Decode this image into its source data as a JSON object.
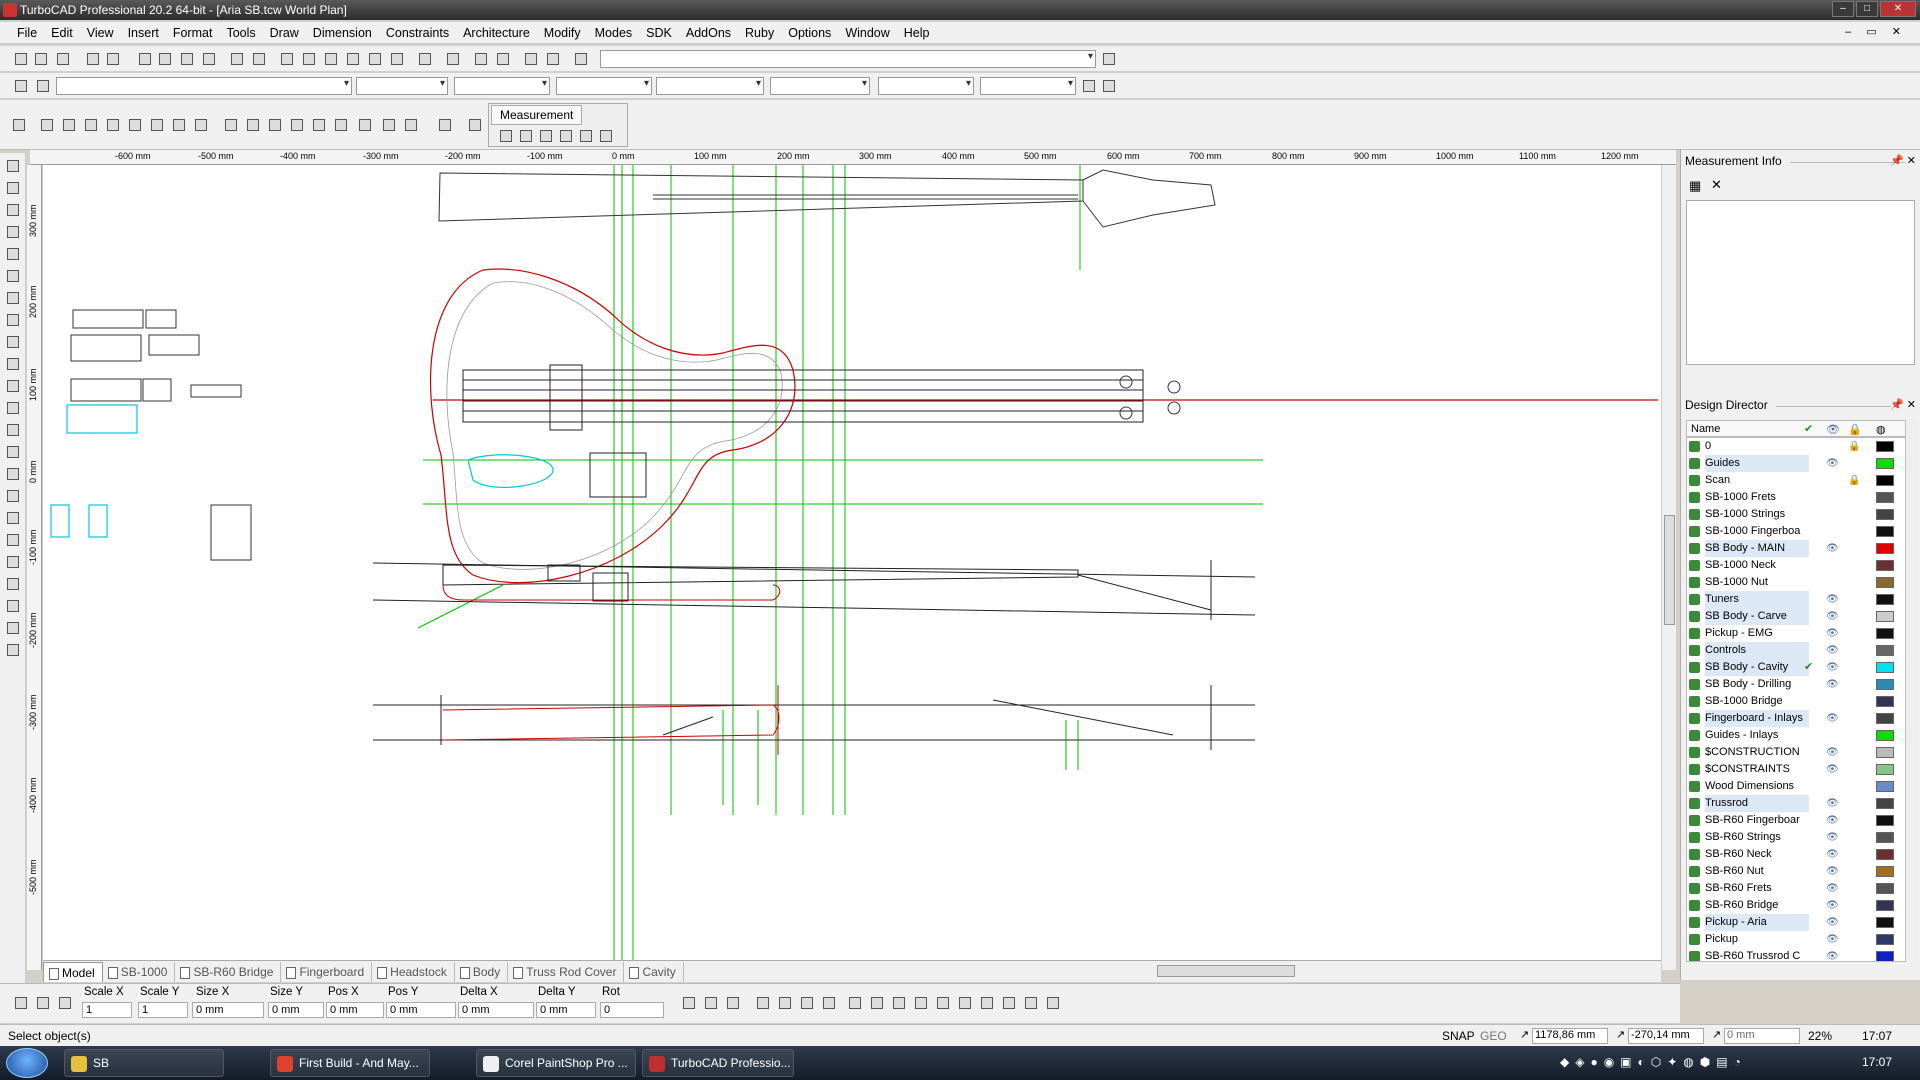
{
  "window": {
    "title": "TurboCAD Professional 20.2 64-bit - [Aria SB.tcw World Plan]",
    "buttons": [
      "–",
      "□",
      "✕"
    ]
  },
  "menu": [
    "File",
    "Edit",
    "View",
    "Insert",
    "Format",
    "Tools",
    "Draw",
    "Dimension",
    "Constraints",
    "Architecture",
    "Modify",
    "Modes",
    "SDK",
    "AddOns",
    "Ruby",
    "Options",
    "Window",
    "Help"
  ],
  "mdi_controls": "– ▭ ✕",
  "measurement_toolbar": {
    "label": "Measurement"
  },
  "ruler_h": [
    "-600 mm",
    "-500 mm",
    "-400 mm",
    "-300 mm",
    "-200 mm",
    "-100 mm",
    "0 mm",
    "100 mm",
    "200 mm",
    "300 mm",
    "400 mm",
    "500 mm",
    "600 mm",
    "700 mm",
    "800 mm",
    "900 mm",
    "1000 mm",
    "1100 mm",
    "1200 mm"
  ],
  "ruler_v": [
    "300 mm",
    "200 mm",
    "100 mm",
    "0 mm",
    "-100 mm",
    "-200 mm",
    "-300 mm",
    "-400 mm",
    "-500 mm"
  ],
  "tabs": [
    "Model",
    "SB-1000",
    "SB-R60 Bridge",
    "Fingerboard",
    "Headstock",
    "Body",
    "Truss Rod Cover",
    "Cavity"
  ],
  "active_tab": "Model",
  "measurement_info": {
    "title": "Measurement Info"
  },
  "design_director": {
    "title": "Design Director",
    "columns": {
      "name": "Name"
    },
    "layers": [
      {
        "name": "0",
        "hl": false,
        "eye": false,
        "lock": true,
        "check": false,
        "color": "#000000"
      },
      {
        "name": "Guides",
        "hl": true,
        "eye": true,
        "lock": false,
        "check": false,
        "color": "#00e000"
      },
      {
        "name": "Scan",
        "hl": false,
        "eye": false,
        "lock": true,
        "check": false,
        "color": "#000000"
      },
      {
        "name": "SB-1000 Frets",
        "hl": false,
        "eye": false,
        "lock": false,
        "check": false,
        "color": "#555555"
      },
      {
        "name": "SB-1000 Strings",
        "hl": false,
        "eye": false,
        "lock": false,
        "check": false,
        "color": "#444444"
      },
      {
        "name": "SB-1000 Fingerboa",
        "hl": false,
        "eye": false,
        "lock": false,
        "check": false,
        "color": "#111111"
      },
      {
        "name": "SB Body - MAIN",
        "hl": true,
        "eye": true,
        "lock": false,
        "check": false,
        "color": "#e00000"
      },
      {
        "name": "SB-1000 Neck",
        "hl": false,
        "eye": false,
        "lock": false,
        "check": false,
        "color": "#6b3030"
      },
      {
        "name": "SB-1000 Nut",
        "hl": false,
        "eye": false,
        "lock": false,
        "check": false,
        "color": "#8a6a2a"
      },
      {
        "name": "Tuners",
        "hl": true,
        "eye": true,
        "lock": false,
        "check": false,
        "color": "#111111"
      },
      {
        "name": "SB Body - Carve",
        "hl": true,
        "eye": true,
        "lock": false,
        "check": false,
        "color": "#cccccc"
      },
      {
        "name": "Pickup - EMG",
        "hl": false,
        "eye": true,
        "lock": false,
        "check": false,
        "color": "#111111"
      },
      {
        "name": "Controls",
        "hl": true,
        "eye": true,
        "lock": false,
        "check": false,
        "color": "#666666"
      },
      {
        "name": "SB Body - Cavity",
        "hl": true,
        "eye": true,
        "lock": false,
        "check": true,
        "color": "#00e0f0"
      },
      {
        "name": "SB Body - Drilling",
        "hl": false,
        "eye": true,
        "lock": false,
        "check": false,
        "color": "#2a8ab0"
      },
      {
        "name": "SB-1000 Bridge",
        "hl": false,
        "eye": false,
        "lock": false,
        "check": false,
        "color": "#333355"
      },
      {
        "name": "Fingerboard - Inlays",
        "hl": true,
        "eye": true,
        "lock": false,
        "check": false,
        "color": "#444444"
      },
      {
        "name": "Guides - Inlays",
        "hl": false,
        "eye": false,
        "lock": false,
        "check": false,
        "color": "#00e000"
      },
      {
        "name": "$CONSTRUCTION",
        "hl": false,
        "eye": true,
        "lock": false,
        "check": false,
        "color": "#bbbbbb"
      },
      {
        "name": "$CONSTRAINTS",
        "hl": false,
        "eye": true,
        "lock": false,
        "check": false,
        "color": "#88c488"
      },
      {
        "name": "Wood Dimensions",
        "hl": false,
        "eye": false,
        "lock": false,
        "check": false,
        "color": "#6a8ad0"
      },
      {
        "name": "Trussrod",
        "hl": true,
        "eye": true,
        "lock": false,
        "check": false,
        "color": "#444444"
      },
      {
        "name": "SB-R60 Fingerboar",
        "hl": false,
        "eye": true,
        "lock": false,
        "check": false,
        "color": "#111111"
      },
      {
        "name": "SB-R60 Strings",
        "hl": false,
        "eye": true,
        "lock": false,
        "check": false,
        "color": "#555555"
      },
      {
        "name": "SB-R60 Neck",
        "hl": false,
        "eye": true,
        "lock": false,
        "check": false,
        "color": "#6b3030"
      },
      {
        "name": "SB-R60 Nut",
        "hl": false,
        "eye": true,
        "lock": false,
        "check": false,
        "color": "#a07020"
      },
      {
        "name": "SB-R60 Frets",
        "hl": false,
        "eye": true,
        "lock": false,
        "check": false,
        "color": "#555555"
      },
      {
        "name": "SB-R60 Bridge",
        "hl": false,
        "eye": true,
        "lock": false,
        "check": false,
        "color": "#333355"
      },
      {
        "name": "Pickup - Aria",
        "hl": true,
        "eye": true,
        "lock": false,
        "check": false,
        "color": "#111111"
      },
      {
        "name": "Pickup",
        "hl": false,
        "eye": true,
        "lock": false,
        "check": false,
        "color": "#2a3a6a"
      },
      {
        "name": "SB-R60 Trussrod C",
        "hl": false,
        "eye": true,
        "lock": false,
        "check": false,
        "color": "#1020c0"
      }
    ]
  },
  "inspector": {
    "labels": [
      "Scale X",
      "Scale Y",
      "Size X",
      "Size Y",
      "Pos X",
      "Pos Y",
      "Delta X",
      "Delta Y",
      "Rot"
    ],
    "values": [
      "1",
      "1",
      "0 mm",
      "0 mm",
      "0 mm",
      "0 mm",
      "0 mm",
      "0 mm",
      "0"
    ]
  },
  "status": {
    "prompt": "Select object(s)",
    "snap": "SNAP",
    "geo": "GEO",
    "x": "1178,86 mm",
    "y": "-270,14 mm",
    "z": "0 mm",
    "zoom": "22%",
    "time": "17:07"
  },
  "taskbar": {
    "items": [
      {
        "label": "SB",
        "color": "#e8c040"
      },
      {
        "label": "First Build - And May...",
        "color": "#e04030"
      },
      {
        "label": "Corel PaintShop Pro ...",
        "color": "#f0f0f0"
      },
      {
        "label": "TurboCAD Professio...",
        "color": "#c03030"
      }
    ],
    "clock": "17:07"
  }
}
